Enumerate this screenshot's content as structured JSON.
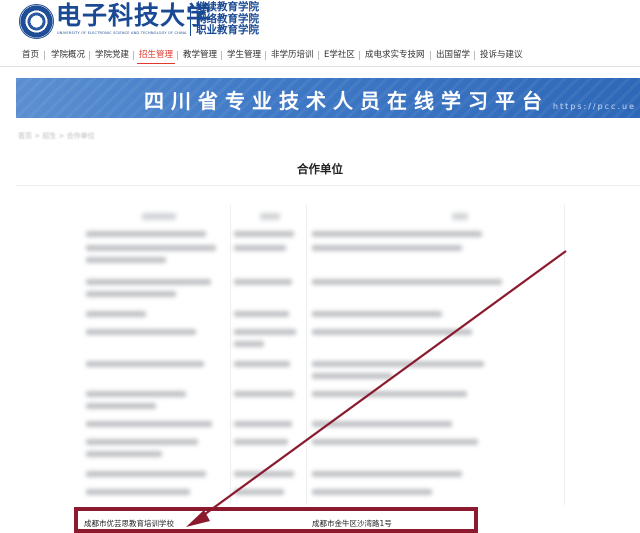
{
  "header": {
    "logo_name": "电子科技大学",
    "logo_english": "UNIVERSITY OF ELECTRONIC SCIENCE AND TECHNOLOGY OF CHINA",
    "sub_lines": [
      "继续教育学院",
      "网络教育学院",
      "职业教育学院"
    ]
  },
  "nav": {
    "items": [
      {
        "label": "首页"
      },
      {
        "label": "学院概况"
      },
      {
        "label": "学院党建"
      },
      {
        "label": "招生管理",
        "active": true
      },
      {
        "label": "教学管理"
      },
      {
        "label": "学生管理"
      },
      {
        "label": "非学历培训"
      },
      {
        "label": "E学社区"
      },
      {
        "label": "成电求实专技网"
      },
      {
        "label": "出国留学"
      },
      {
        "label": "投诉与建议"
      }
    ],
    "active_color": "#e03a2e"
  },
  "banner": {
    "title": "四川省专业技术人员在线学习平台",
    "url_text": "https://pcc.ue",
    "color": "#3f79c6"
  },
  "breadcrumb": "首页 > 招生 > 合作单位",
  "page_title": "合作单位",
  "highlighted_row": {
    "name": "成都市优芸思教育培训学校",
    "address": "成都市金牛区沙湾路1号"
  },
  "annotation": {
    "color": "#8b1a2e",
    "shape": "arrow-to-highlight"
  }
}
